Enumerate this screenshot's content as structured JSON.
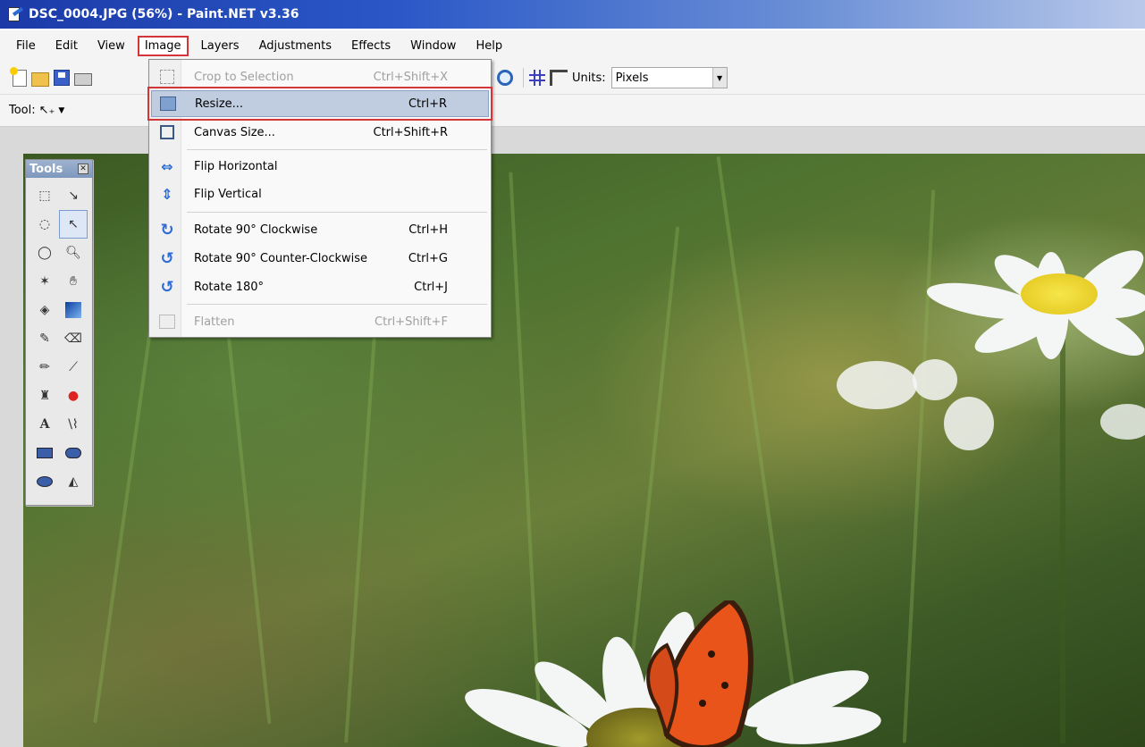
{
  "window": {
    "title": "DSC_0004.JPG (56%) - Paint.NET v3.36"
  },
  "menubar": {
    "items": [
      {
        "label": "File"
      },
      {
        "label": "Edit"
      },
      {
        "label": "View"
      },
      {
        "label": "Image"
      },
      {
        "label": "Layers"
      },
      {
        "label": "Adjustments"
      },
      {
        "label": "Effects"
      },
      {
        "label": "Window"
      },
      {
        "label": "Help"
      }
    ],
    "open_menu": "Image"
  },
  "toolbar": {
    "units_label": "Units:",
    "units_value": "Pixels"
  },
  "toolrow": {
    "tool_label": "Tool:",
    "current_tool_icon": "move-selection-icon"
  },
  "tools_palette": {
    "title": "Tools",
    "tools": [
      "rectangle-select-icon",
      "move-selected-pixels-icon",
      "lasso-select-icon",
      "move-selection-icon",
      "ellipse-select-icon",
      "zoom-icon",
      "magic-wand-icon",
      "pan-icon",
      "paint-bucket-icon",
      "gradient-icon",
      "paintbrush-icon",
      "eraser-icon",
      "pencil-icon",
      "color-picker-icon",
      "clone-stamp-icon",
      "recolor-icon",
      "text-icon",
      "line-curve-icon",
      "rectangle-icon",
      "rounded-rectangle-icon",
      "ellipse-icon",
      "freeform-shape-icon"
    ]
  },
  "image_menu": {
    "items": [
      {
        "label": "Crop to Selection",
        "shortcut": "Ctrl+Shift+X",
        "icon": "crop-icon",
        "enabled": false
      },
      {
        "label": "Resize...",
        "shortcut": "Ctrl+R",
        "icon": "resize-icon",
        "enabled": true,
        "highlighted": true
      },
      {
        "label": "Canvas Size...",
        "shortcut": "Ctrl+Shift+R",
        "icon": "canvas-size-icon",
        "enabled": true
      },
      {
        "label": "Flip Horizontal",
        "shortcut": "",
        "icon": "flip-horizontal-icon",
        "enabled": true
      },
      {
        "label": "Flip Vertical",
        "shortcut": "",
        "icon": "flip-vertical-icon",
        "enabled": true
      },
      {
        "label": "Rotate 90° Clockwise",
        "shortcut": "Ctrl+H",
        "icon": "rotate-clockwise-icon",
        "enabled": true
      },
      {
        "label": "Rotate 90° Counter-Clockwise",
        "shortcut": "Ctrl+G",
        "icon": "rotate-counterclockwise-icon",
        "enabled": true
      },
      {
        "label": "Rotate 180°",
        "shortcut": "Ctrl+J",
        "icon": "rotate-180-icon",
        "enabled": true
      },
      {
        "label": "Flatten",
        "shortcut": "Ctrl+Shift+F",
        "icon": "flatten-icon",
        "enabled": false
      }
    ]
  },
  "colors": {
    "highlight_box": "#d43536",
    "menu_highlight": "#c0cde0",
    "titlebar_start": "#1b3aa8"
  }
}
